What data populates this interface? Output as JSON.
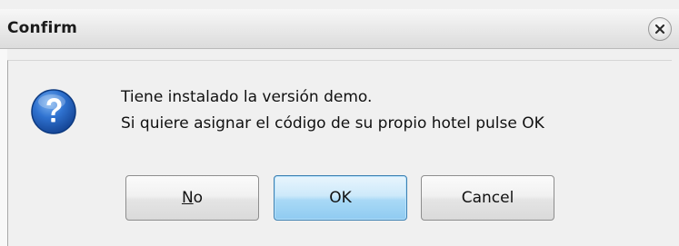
{
  "window": {
    "title": "Confirm",
    "close_icon": "close-icon"
  },
  "message": {
    "icon": "question-icon",
    "line1": "Tiene instalado la versión demo.",
    "line2": "Si quiere asignar el código de su propio hotel pulse OK"
  },
  "buttons": {
    "no_mnemonic": "N",
    "no_rest": "o",
    "ok_label": "OK",
    "cancel_label": "Cancel"
  },
  "colors": {
    "ok_accent": "#8fcbf1",
    "question_icon": "#1f5fb8"
  }
}
